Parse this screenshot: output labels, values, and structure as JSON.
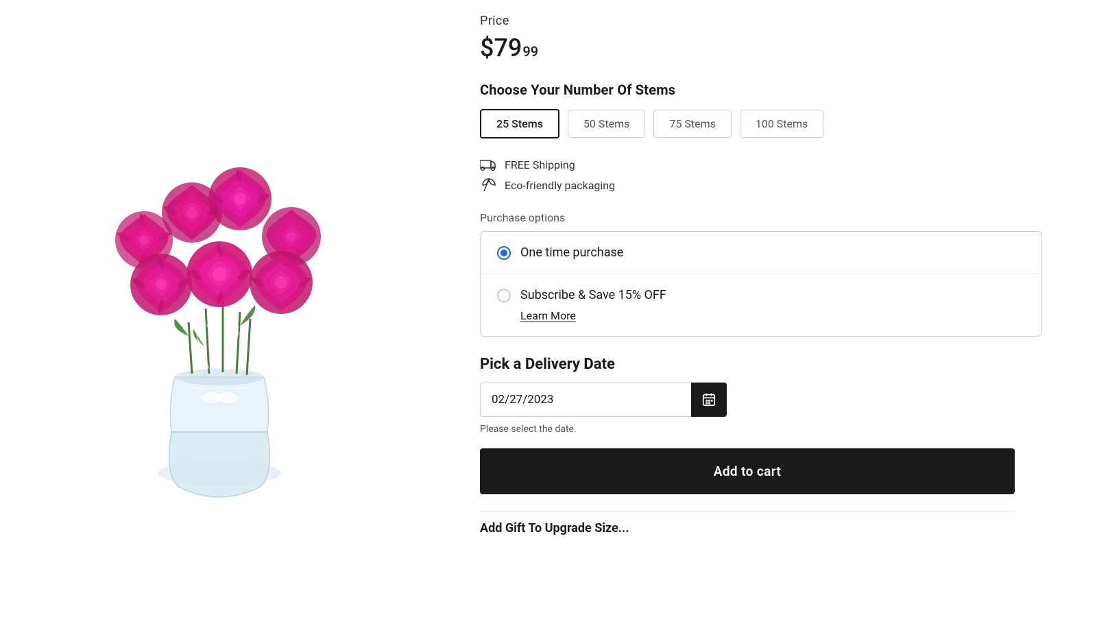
{
  "product": {
    "price_label": "Price",
    "price_main": "$79",
    "price_cents": "99",
    "stems_label": "Choose Your Number Of Stems",
    "stems_options": [
      {
        "label": "25 Stems",
        "selected": true
      },
      {
        "label": "50 Stems",
        "selected": false
      },
      {
        "label": "75 Stems",
        "selected": false
      },
      {
        "label": "100 Stems",
        "selected": false
      }
    ],
    "features": [
      {
        "icon": "truck-icon",
        "text": "FREE Shipping"
      },
      {
        "icon": "leaf-icon",
        "text": "Eco-friendly packaging"
      }
    ],
    "purchase_options_label": "Purchase options",
    "purchase_options": [
      {
        "label": "One time purchase",
        "checked": true
      },
      {
        "label": "Subscribe & Save 15% OFF",
        "checked": false
      }
    ],
    "learn_more_label": "Learn More",
    "delivery_label": "Pick a Delivery Date",
    "delivery_date_value": "02/27/2023",
    "delivery_hint": "Please select the date.",
    "add_to_cart_label": "Add to cart",
    "bottom_section_label": "Add Gift To Upgrade Size..."
  }
}
